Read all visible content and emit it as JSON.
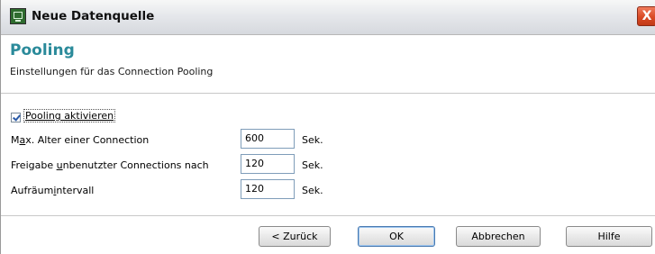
{
  "window": {
    "title": "Neue Datenquelle",
    "close_label": "X"
  },
  "header": {
    "title": "Pooling",
    "subtitle": "Einstellungen für das Connection Pooling"
  },
  "pooling": {
    "enable_label": "Pooling aktivieren",
    "enabled": true
  },
  "settings": [
    {
      "label_pre": "M",
      "label_accel": "a",
      "label_post": "x. Alter einer Connection",
      "value": "600",
      "unit": "Sek."
    },
    {
      "label_pre": "Freigabe ",
      "label_accel": "u",
      "label_post": "nbenutzter Connections nach",
      "value": "120",
      "unit": "Sek."
    },
    {
      "label_pre": "Aufräum",
      "label_accel": "i",
      "label_post": "ntervall",
      "value": "120",
      "unit": "Sek."
    }
  ],
  "buttons": {
    "back": "< Zurück",
    "ok": "OK",
    "cancel": "Abbrechen",
    "help": "Hilfe"
  }
}
